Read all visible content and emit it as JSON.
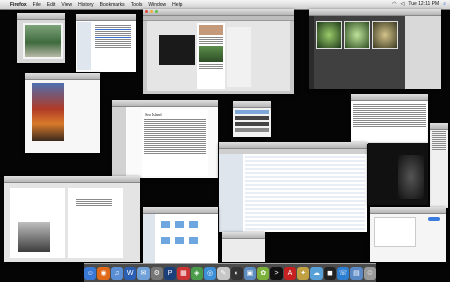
{
  "menubar": {
    "apple_glyph": "",
    "app_name": "Firefox",
    "items": [
      "File",
      "Edit",
      "View",
      "History",
      "Bookmarks",
      "Tools",
      "Window",
      "Help"
    ],
    "clock": "Tue 12:11 PM",
    "spotlight_glyph": "⌕"
  },
  "icons": {
    "spotlight": "search-icon",
    "wifi": "wifi-icon",
    "volume": "volume-icon"
  },
  "book_window": {
    "heading": "Sea Island"
  },
  "dock": {
    "items": [
      {
        "name": "finder",
        "color": "#3a78d8",
        "glyph": "☺"
      },
      {
        "name": "firefox",
        "color": "#e06a1a",
        "glyph": "◉"
      },
      {
        "name": "itunes",
        "color": "#5a8fd6",
        "glyph": "♫"
      },
      {
        "name": "word",
        "color": "#2b5fb4",
        "glyph": "W"
      },
      {
        "name": "mail",
        "color": "#6fa0d8",
        "glyph": "✉"
      },
      {
        "name": "system-preferences",
        "color": "#777777",
        "glyph": "⚙"
      },
      {
        "name": "photoshop",
        "color": "#1b3f7a",
        "glyph": "P"
      },
      {
        "name": "ical",
        "color": "#cc3333",
        "glyph": "▦"
      },
      {
        "name": "preview",
        "color": "#4a9b4a",
        "glyph": "◈"
      },
      {
        "name": "safari",
        "color": "#3d8fd8",
        "glyph": "◎"
      },
      {
        "name": "textedit",
        "color": "#c6c6c6",
        "glyph": "✎"
      },
      {
        "name": "dashboard",
        "color": "#333333",
        "glyph": "◐"
      },
      {
        "name": "iphoto",
        "color": "#5c8cc0",
        "glyph": "▣"
      },
      {
        "name": "adium",
        "color": "#7bb03a",
        "glyph": "✿"
      },
      {
        "name": "terminal",
        "color": "#111111",
        "glyph": ">"
      },
      {
        "name": "acrobat",
        "color": "#c62020",
        "glyph": "A"
      },
      {
        "name": "network-utility",
        "color": "#c0a040",
        "glyph": "✦"
      },
      {
        "name": "chat",
        "color": "#58a0d8",
        "glyph": "☁"
      },
      {
        "name": "dvd-player",
        "color": "#222222",
        "glyph": "◼"
      },
      {
        "name": "ichat",
        "color": "#2d7ed0",
        "glyph": "☏"
      },
      {
        "name": "applications-folder",
        "color": "#5b89c6",
        "glyph": "▤"
      },
      {
        "name": "trash",
        "color": "#9a9a9a",
        "glyph": "♲"
      }
    ]
  }
}
